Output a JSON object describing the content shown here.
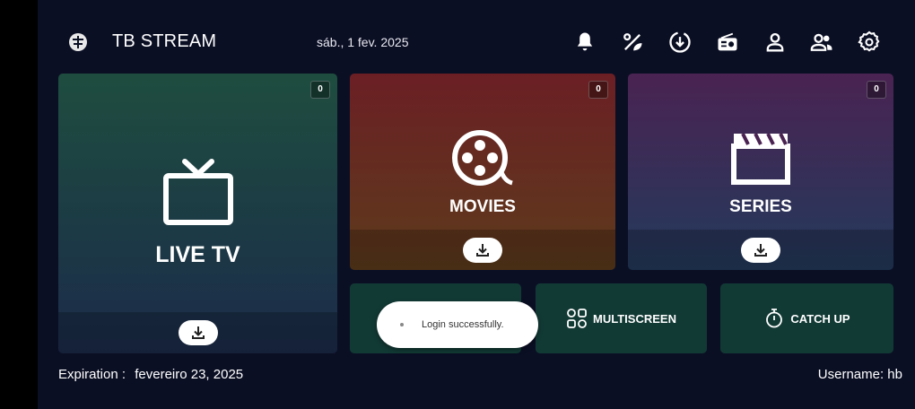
{
  "header": {
    "app_name": "TB STREAM",
    "date": "sáb., 1 fev. 2025",
    "icons": [
      "bell-icon",
      "percent-leaf-icon",
      "download-circle-icon",
      "radio-icon",
      "user-icon",
      "users-icon",
      "settings-icon"
    ]
  },
  "tiles": {
    "live_tv": {
      "label": "LIVE TV",
      "count": "0"
    },
    "movies": {
      "label": "MOVIES",
      "count": "0"
    },
    "series": {
      "label": "SERIES",
      "count": "0"
    },
    "multiscreen": {
      "label": "MULTISCREEN"
    },
    "catch_up": {
      "label": "CATCH UP"
    }
  },
  "toast": {
    "message": "Login successfully."
  },
  "footer": {
    "expiration_label": "Expiration :",
    "expiration_value": "fevereiro 23, 2025",
    "username": "Username: hb"
  },
  "colors": {
    "background": "#0b0f24",
    "live_tv_top": "#1e4d3f",
    "live_tv_bottom": "#1b2b4a",
    "movies_top": "#6b1f24",
    "movies_bottom": "#5d3b1c",
    "series_top": "#4a2352",
    "series_bottom": "#233a5c",
    "small_tile": "#123a35"
  }
}
